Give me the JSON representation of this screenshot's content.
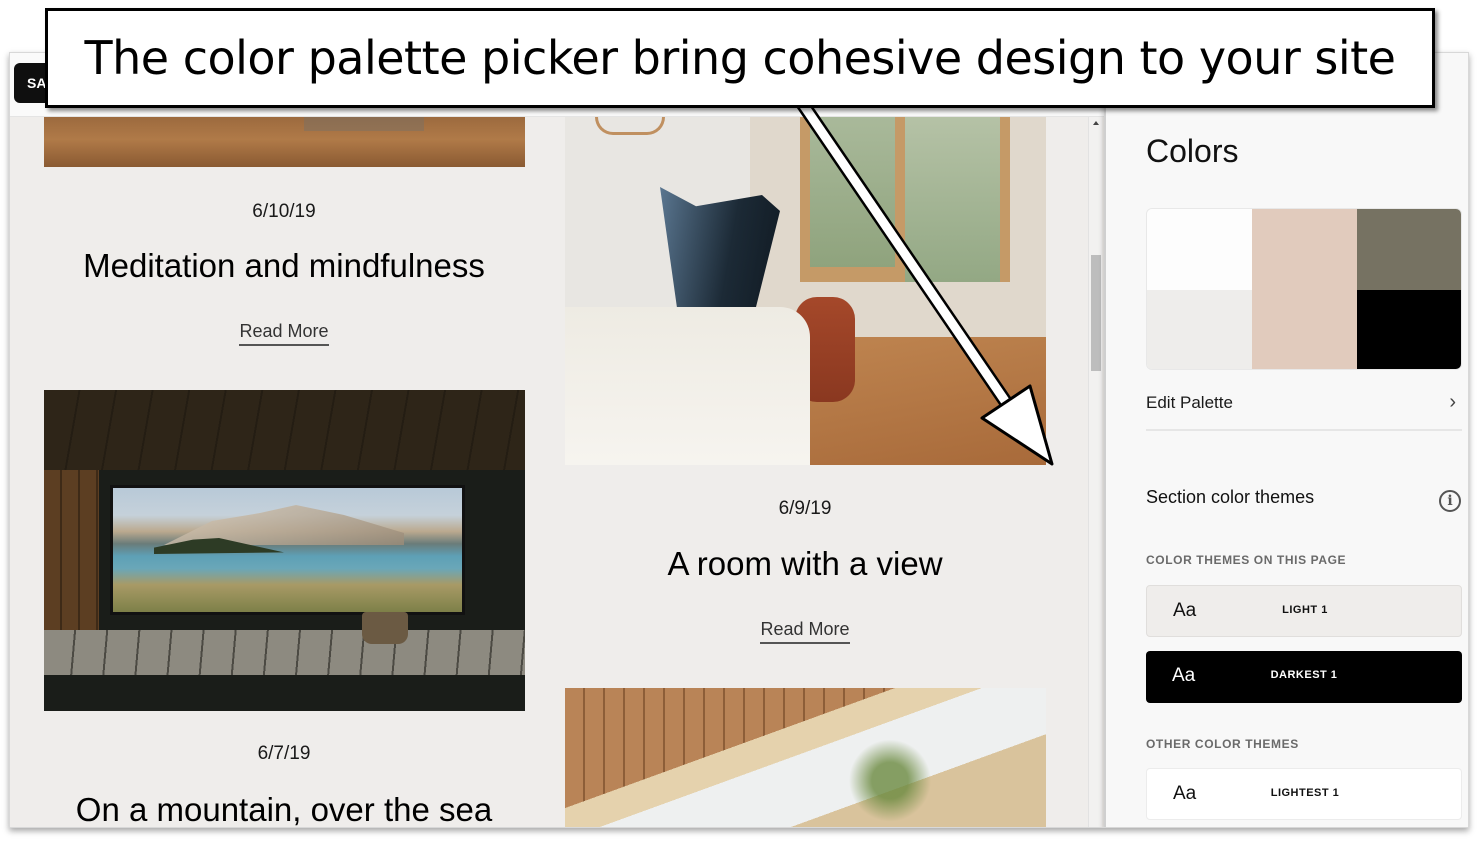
{
  "annotation": {
    "banner_text": "The color palette picker bring cohesive design to your site",
    "arrow": "arrow-pointing-to-colors-panel"
  },
  "toolbar": {
    "save_label_visible": "SA"
  },
  "site": {
    "posts": [
      {
        "date": "6/10/19",
        "title": "Meditation and mindfulness",
        "read_more": "Read More",
        "image": "golden-grass-field-photo"
      },
      {
        "date": "6/9/19",
        "title": "A room with a view",
        "read_more": "Read More",
        "image": "bedroom-butterfly-chair-photo"
      },
      {
        "date": "6/7/19",
        "title": "On a mountain, over the sea",
        "image": "sauna-window-mountain-lake-photo"
      },
      {
        "image": "wooden-cabin-beams-photo"
      }
    ]
  },
  "panel": {
    "title": "Colors",
    "palette": {
      "colors": [
        "#fdfdfd",
        "#eeedeb",
        "#e1cbbd",
        "#767262",
        "#000000"
      ]
    },
    "edit_palette_label": "Edit Palette",
    "section_color_themes_label": "Section color themes",
    "on_this_page_label": "COLOR THEMES ON THIS PAGE",
    "on_this_page_themes": [
      {
        "sample": "Aa",
        "name": "LIGHT 1"
      },
      {
        "sample": "Aa",
        "name": "DARKEST 1"
      }
    ],
    "other_label": "OTHER COLOR THEMES",
    "other_themes": [
      {
        "sample": "Aa",
        "name": "LIGHTEST 1"
      }
    ]
  }
}
